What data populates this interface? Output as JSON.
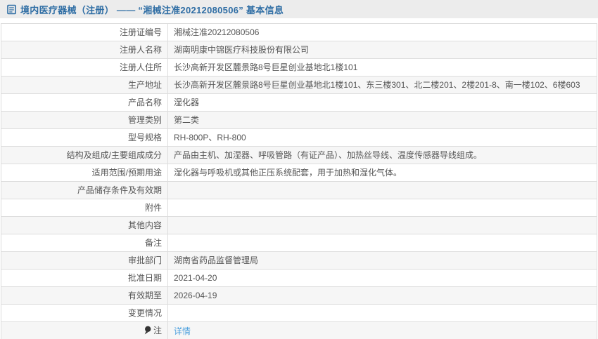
{
  "header": {
    "title": "境内医疗器械（注册） —— “湘械注准20212080506” 基本信息"
  },
  "table": {
    "rows": [
      {
        "label": "注册证编号",
        "value": "湘械注准20212080506"
      },
      {
        "label": "注册人名称",
        "value": "湖南明康中锦医疗科技股份有限公司"
      },
      {
        "label": "注册人住所",
        "value": "长沙高新开发区麓景路8号巨星创业基地北1楼101"
      },
      {
        "label": "生产地址",
        "value": "长沙高新开发区麓景路8号巨星创业基地北1楼101、东三楼301、北二楼201、2楼201-8、南一楼102、6楼603"
      },
      {
        "label": "产品名称",
        "value": "湿化器"
      },
      {
        "label": "管理类别",
        "value": "第二类"
      },
      {
        "label": "型号规格",
        "value": "RH-800P、RH-800"
      },
      {
        "label": "结构及组成/主要组成成分",
        "value": "产品由主机、加湿器、呼吸管路（有证产品）、加热丝导线、温度传感器导线组成。"
      },
      {
        "label": "适用范围/预期用途",
        "value": "湿化器与呼吸机或其他正压系统配套，用于加热和湿化气体。"
      },
      {
        "label": "产品储存条件及有效期",
        "value": ""
      },
      {
        "label": "附件",
        "value": ""
      },
      {
        "label": "其他内容",
        "value": ""
      },
      {
        "label": "备注",
        "value": ""
      },
      {
        "label": "审批部门",
        "value": "湖南省药品监督管理局"
      },
      {
        "label": "批准日期",
        "value": "2021-04-20"
      },
      {
        "label": "有效期至",
        "value": "2026-04-19"
      },
      {
        "label": "变更情况",
        "value": ""
      },
      {
        "label": "注",
        "value": "详情"
      }
    ]
  },
  "colors": {
    "accent_blue": "#2e6da4",
    "link_blue": "#4a9fdd",
    "header_bg": "#ececec",
    "stripe_bg": "#f6f6f6",
    "border": "#dddddd"
  }
}
